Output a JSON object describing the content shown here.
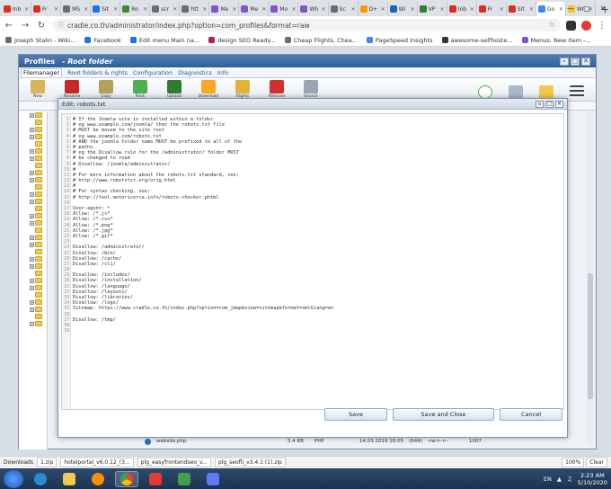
{
  "browser": {
    "tabs": [
      {
        "label": "Inb",
        "color": "#d93025"
      },
      {
        "label": "Fr",
        "color": "#d93025"
      },
      {
        "label": "MS",
        "color": "#6d6d6d"
      },
      {
        "label": "Sit",
        "color": "#1a73e8"
      },
      {
        "label": "Ro",
        "color": "#3c8d2f"
      },
      {
        "label": "scr",
        "color": "#6d6d6d"
      },
      {
        "label": "htt",
        "color": "#6d6d6d"
      },
      {
        "label": "Me",
        "color": "#7e57c2"
      },
      {
        "label": "Me",
        "color": "#7e57c2"
      },
      {
        "label": "Mo",
        "color": "#7e57c2"
      },
      {
        "label": "Wh",
        "color": "#7e57c2"
      },
      {
        "label": "Sc",
        "color": "#6d6d6d"
      },
      {
        "label": "D+",
        "color": "#ff9800"
      },
      {
        "label": "Wi",
        "color": "#1565c0"
      },
      {
        "label": "VP",
        "color": "#2e7d32"
      },
      {
        "label": "Inb",
        "color": "#d93025"
      },
      {
        "label": "Fr",
        "color": "#d93025"
      },
      {
        "label": "Sit",
        "color": "#d93025"
      },
      {
        "label": "Go",
        "color": "#4285f4"
      },
      {
        "label": "Wr",
        "color": "#fbc02d"
      }
    ],
    "url": "cradle.co.th/administrator/index.php?option=com_profiles&format=raw",
    "bookmarks": [
      {
        "label": "Joseph Stalin - Wiki...",
        "color": "#6d6d6d"
      },
      {
        "label": "Facebook",
        "color": "#1877f2"
      },
      {
        "label": "Edit menu Main na...",
        "color": "#1a73e8"
      },
      {
        "label": "design SEO Ready...",
        "color": "#c2185b"
      },
      {
        "label": "Cheap Flights, Chea...",
        "color": "#6d6d6d"
      },
      {
        "label": "PageSpeed Insights",
        "color": "#4285f4"
      },
      {
        "label": "awesome-selfhoste...",
        "color": "#333333"
      },
      {
        "label": "Menus: New Item -...",
        "color": "#7e57c2"
      }
    ]
  },
  "app": {
    "title": "Profiles",
    "subtitle": "- Root folder",
    "menu": [
      "Filemanager",
      "Root folders & rights",
      "Configuration",
      "Diagnostics",
      "Info"
    ],
    "toolbar": [
      {
        "label": "New",
        "color": "#d8b35a"
      },
      {
        "label": "Rename",
        "color": "#c62828"
      },
      {
        "label": "Copy",
        "color": "#b4a05a"
      },
      {
        "label": "Pack",
        "color": "#4caf50"
      },
      {
        "label": "Upload",
        "color": "#2e7d32"
      },
      {
        "label": "Download",
        "color": "#f9a825"
      },
      {
        "label": "Rights",
        "color": "#e0b33a"
      },
      {
        "label": "Remove",
        "color": "#d32f2f"
      },
      {
        "label": "Search",
        "color": "#9aa5b1"
      }
    ],
    "file_row": {
      "name": "website.php",
      "size": "5.4 KB",
      "type": "PHP",
      "date": "14.03.2019 16:05",
      "perm": "(644)",
      "rwx": "-rw-r--r--",
      "id": "1007"
    }
  },
  "dialog": {
    "title": "Edit: robots.txt",
    "lines": [
      "# If the Joomla site is installed within a folder",
      "# eg www.example.com/joomla/ then the robots.txt file",
      "# MUST be moved to the site root",
      "# eg www.example.com/robots.txt",
      "# AND the joomla folder name MUST be prefixed to all of the",
      "# paths.",
      "# eg the Disallow rule for the /administrator/ folder MUST",
      "# be changed to read",
      "# Disallow: /joomla/administrator/",
      "#",
      "# For more information about the robots.txt standard, see:",
      "# http://www.robotstxt.org/orig.html",
      "#",
      "# For syntax checking, see:",
      "# http://tool.motoricerca.info/robots-checker.phtml",
      "",
      "User-agent: *",
      "Allow: /*.js*",
      "Allow: /*.css*",
      "Allow: /*.png*",
      "Allow: /*.jpg*",
      "Allow: /*.gif*",
      "",
      "Disallow: /administrator/",
      "Disallow: /bin/",
      "Disallow: /cache/",
      "Disallow: /cli/",
      "",
      "Disallow: /includes/",
      "Disallow: /installation/",
      "Disallow: /language/",
      "Disallow: /layouts/",
      "Disallow: /libraries/",
      "Disallow: /logs/",
      "Sitemap: https://www.cradle.co.th/index.php?option=com_jmap&view=sitemap&format=xml&lang=en",
      "",
      "Disallow: /tmp/",
      "",
      ""
    ],
    "save_label": "Save",
    "save_close_label": "Save and Close",
    "cancel_label": "Cancel"
  },
  "downloads": {
    "label": "Downloads",
    "items": [
      "1.zip",
      "hotelportal_v6.0.12_(3...",
      "plg_easyfrontendseo_v...",
      "plg_seofli_v3.4.1 (1).zip"
    ],
    "zoom": "100%",
    "clear_label": "Clear"
  },
  "taskbar": {
    "lang": "EN",
    "time": "2:23 AM",
    "date": "5/10/2020"
  }
}
